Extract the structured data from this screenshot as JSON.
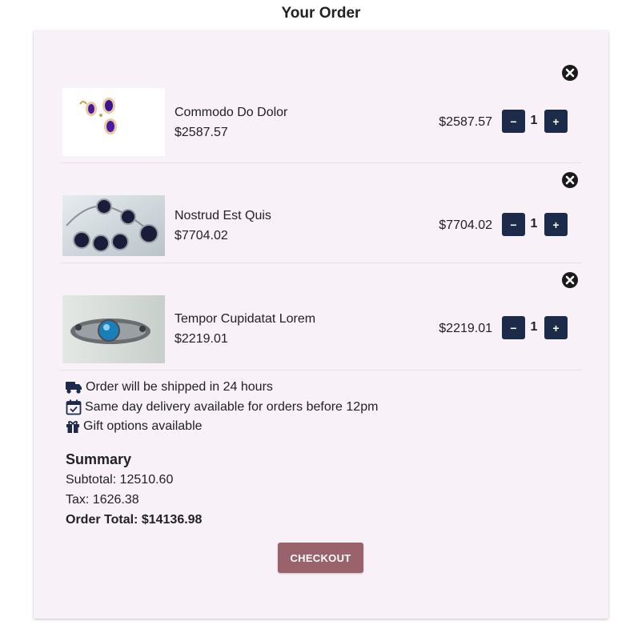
{
  "title": "Your Order",
  "items": [
    {
      "name": "Commodo Do Dolor",
      "price": "$2587.57",
      "line_total": "$2587.57",
      "qty": "1",
      "image": "earrings-icon"
    },
    {
      "name": "Nostrud Est Quis",
      "price": "$7704.02",
      "line_total": "$7704.02",
      "qty": "1",
      "image": "necklace-icon"
    },
    {
      "name": "Tempor Cupidatat Lorem",
      "price": "$2219.01",
      "line_total": "$2219.01",
      "qty": "1",
      "image": "bracelet-icon"
    }
  ],
  "qty_controls": {
    "minus": "−",
    "plus": "+"
  },
  "info": {
    "shipping": "Order will be shipped in 24 hours",
    "delivery": "Same day delivery available for orders before 12pm",
    "gift": "Gift options available"
  },
  "summary": {
    "heading": "Summary",
    "subtotal": "Subtotal: 12510.60",
    "tax": "Tax: 1626.38",
    "total": "Order Total: $14136.98"
  },
  "checkout_label": "CHECKOUT",
  "colors": {
    "card_bg": "#f8f1f8",
    "qty_button": "#1c2b4a",
    "checkout_button": "#9a626a"
  }
}
